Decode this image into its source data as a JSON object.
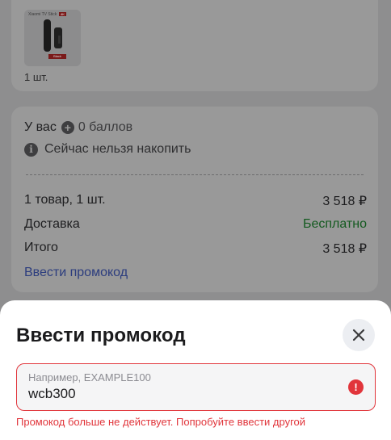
{
  "product": {
    "image_brand_text": "Xiaomi TV Stick",
    "image_badge": "4K",
    "image_box_label": "Black",
    "quantity": "1 шт."
  },
  "points": {
    "prefix": "У вас",
    "value": "0 баллов",
    "info": "Сейчас нельзя накопить"
  },
  "summary": {
    "items_label": "1 товар, 1 шт.",
    "items_value": "3 518 ₽",
    "delivery_label": "Доставка",
    "delivery_value": "Бесплатно",
    "total_label": "Итого",
    "total_value": "3 518 ₽",
    "promo_link": "Ввести промокод"
  },
  "sheet": {
    "title": "Ввести промокод",
    "placeholder": "Например, EXAMPLE100",
    "value": "wcb300",
    "error": "Промокод больше не действует. Попробуйте ввести другой"
  },
  "colors": {
    "error": "#e1353b",
    "link": "#2c3d7e",
    "free": "#135a1f"
  }
}
